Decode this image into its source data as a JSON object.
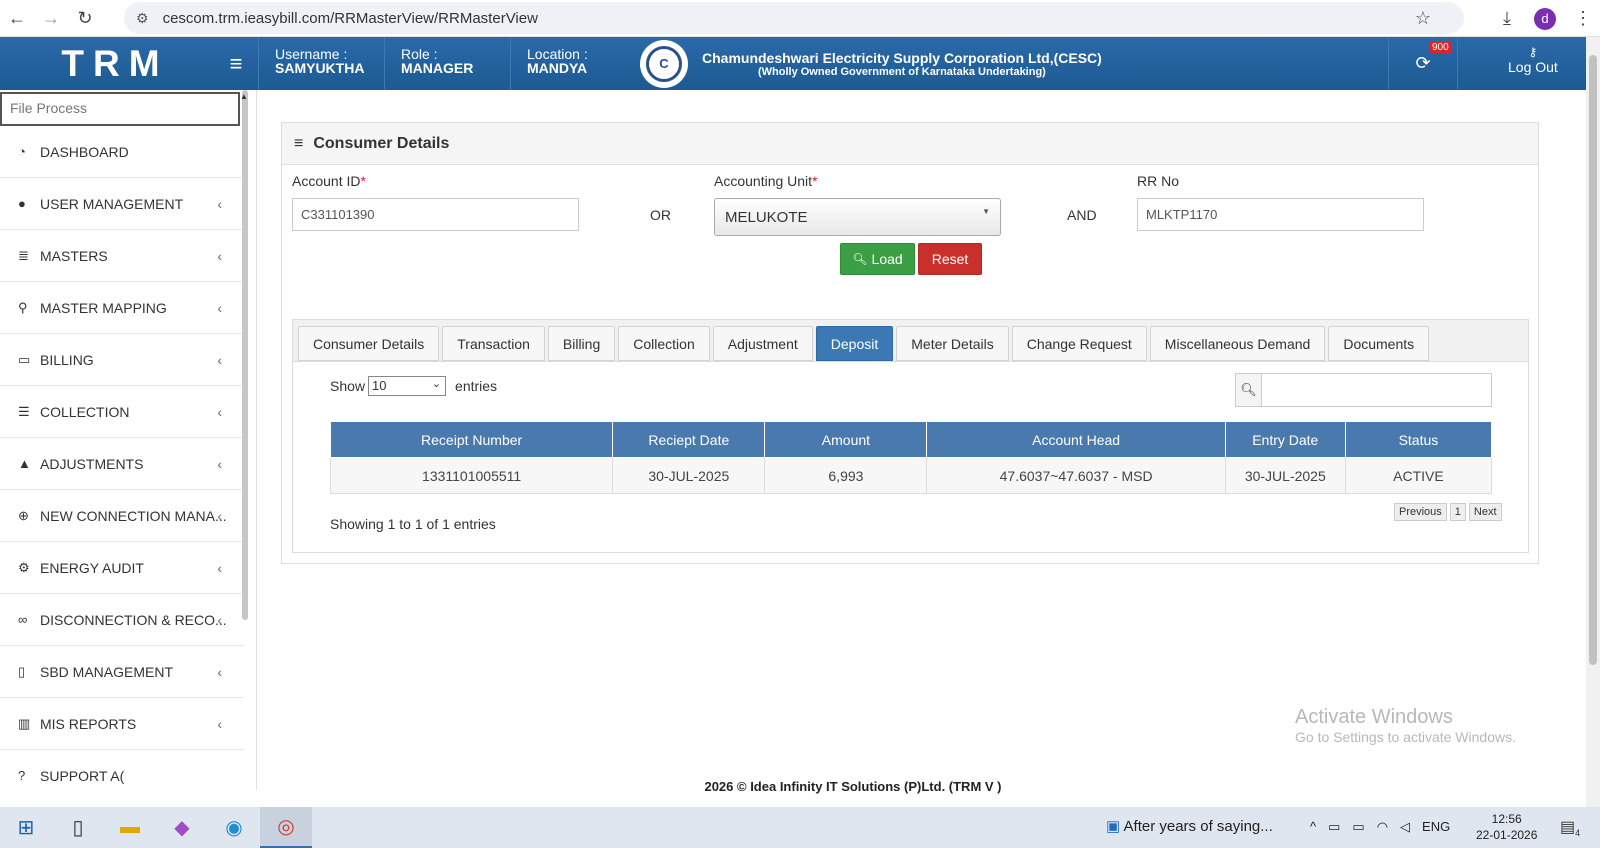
{
  "browser": {
    "url": "cescom.trm.ieasybill.com/RRMasterView/RRMasterView",
    "avatar_letter": "d"
  },
  "header": {
    "logo": "TRM",
    "username_label": "Username :",
    "username": "SAMYUKTHA",
    "role_label": "Role :",
    "role": "MANAGER",
    "location_label": "Location :",
    "location": "MANDYA",
    "corp_name": "Chamundeshwari Electricity Supply Corporation Ltd,(CESC)",
    "corp_sub": "(Wholly Owned Government of Karnataka Undertaking)",
    "notif_count": "900",
    "logout": "Log Out"
  },
  "sidebar": {
    "search_placeholder": "File Process",
    "items": [
      {
        "label": "DASHBOARD",
        "icon": "dashboard-icon",
        "chev": ""
      },
      {
        "label": "USER MANAGEMENT",
        "icon": "user-icon",
        "chev": "‹"
      },
      {
        "label": "MASTERS",
        "icon": "list-icon",
        "chev": "‹"
      },
      {
        "label": "MASTER MAPPING",
        "icon": "sitemap-icon",
        "chev": "‹"
      },
      {
        "label": "BILLING",
        "icon": "desktop-icon",
        "chev": "‹"
      },
      {
        "label": "COLLECTION",
        "icon": "list-ol-icon",
        "chev": "‹"
      },
      {
        "label": "ADJUSTMENTS",
        "icon": "adjust-icon",
        "chev": "‹"
      },
      {
        "label": "NEW CONNECTION MANA...",
        "icon": "plus-circle-icon",
        "chev": "‹"
      },
      {
        "label": "ENERGY AUDIT",
        "icon": "gears-icon",
        "chev": "‹"
      },
      {
        "label": "DISCONNECTION & RECO...",
        "icon": "link-icon",
        "chev": "‹"
      },
      {
        "label": "SBD MANAGEMENT",
        "icon": "mobile-icon",
        "chev": "‹"
      },
      {
        "label": "MIS REPORTS",
        "icon": "bar-chart-icon",
        "chev": "‹"
      },
      {
        "label": "SUPPORT A(",
        "icon": "support-icon",
        "chev": ""
      }
    ]
  },
  "panel": {
    "title": "Consumer Details",
    "account_label": "Account ID",
    "account_value": "C331101390",
    "or": "OR",
    "unit_label": "Accounting Unit",
    "unit_value": "MELUKOTE",
    "and": "AND",
    "rr_label": "RR No",
    "rr_value": "MLKTP1170",
    "load": "Load",
    "reset": "Reset",
    "required_mark": "*"
  },
  "tabs": [
    {
      "label": "Consumer Details",
      "active": false
    },
    {
      "label": "Transaction",
      "active": false
    },
    {
      "label": "Billing",
      "active": false
    },
    {
      "label": "Collection",
      "active": false
    },
    {
      "label": "Adjustment",
      "active": false
    },
    {
      "label": "Deposit",
      "active": true
    },
    {
      "label": "Meter Details",
      "active": false
    },
    {
      "label": "Change Request",
      "active": false
    },
    {
      "label": "Miscellaneous Demand",
      "active": false
    },
    {
      "label": "Documents",
      "active": false
    }
  ],
  "table": {
    "show": "Show",
    "entries_value": "10",
    "entries": "entries",
    "columns": [
      "Receipt Number",
      "Reciept Date",
      "Amount",
      "Account Head",
      "Entry Date",
      "Status"
    ],
    "rows": [
      [
        "1331101005511",
        "30-JUL-2025",
        "6,993",
        "47.6037~47.6037 - MSD",
        "30-JUL-2025",
        "ACTIVE"
      ]
    ],
    "info": "Showing 1 to 1 of 1 entries",
    "prev": "Previous",
    "page": "1",
    "next": "Next"
  },
  "footer": "2026 © Idea Infinity IT Solutions (P)Ltd. (TRM V )",
  "watermark": {
    "line1": "Activate Windows",
    "line2": "Go to Settings to activate Windows."
  },
  "taskbar": {
    "news": "After years of saying...",
    "lang": "ENG",
    "time": "12:56",
    "date": "22-01-2026",
    "notif": "4"
  }
}
